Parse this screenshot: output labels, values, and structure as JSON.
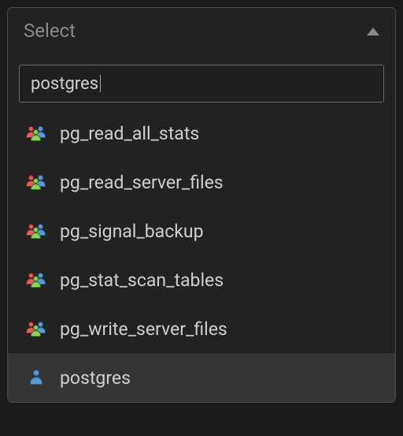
{
  "select": {
    "placeholder": "Select",
    "search_value": "postgres",
    "options": [
      {
        "label": "pg_read_all_stats",
        "icon": "group",
        "highlighted": false
      },
      {
        "label": "pg_read_server_files",
        "icon": "group",
        "highlighted": false
      },
      {
        "label": "pg_signal_backup",
        "icon": "group",
        "highlighted": false
      },
      {
        "label": "pg_stat_scan_tables",
        "icon": "group",
        "highlighted": false
      },
      {
        "label": "pg_write_server_files",
        "icon": "group",
        "highlighted": false
      },
      {
        "label": "postgres",
        "icon": "user",
        "highlighted": true
      }
    ]
  }
}
